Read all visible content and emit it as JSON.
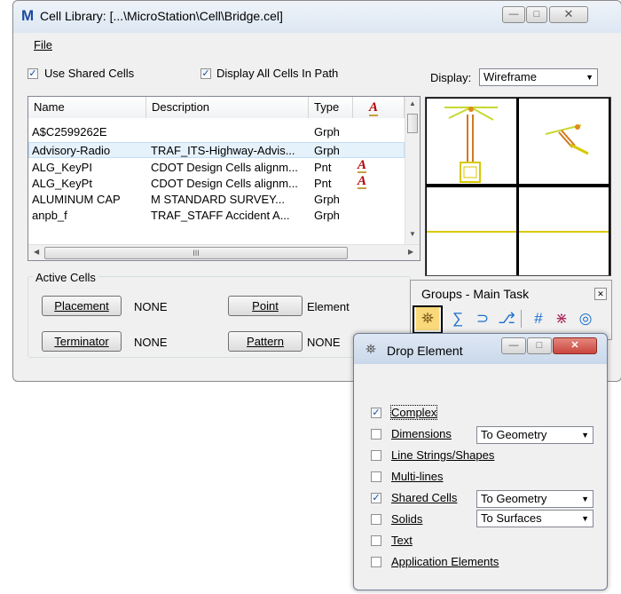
{
  "cell_library": {
    "title": "Cell Library: [...\\MicroStation\\Cell\\Bridge.cel]",
    "menu": {
      "file": "File"
    },
    "use_shared_cells": {
      "label": "Use Shared Cells",
      "checked": true
    },
    "display_all_cells": {
      "label": "Display All Cells In Path",
      "checked": true
    },
    "display": {
      "label": "Display:",
      "value": "Wireframe"
    },
    "columns": [
      "Name",
      "Description",
      "Type"
    ],
    "rows": [
      {
        "name": "A$C2599262E",
        "description": "",
        "type": "Grph",
        "default": false,
        "selected": false
      },
      {
        "name": "Advisory-Radio",
        "description": "TRAF_ITS-Highway-Advis...",
        "type": "Grph",
        "default": false,
        "selected": true
      },
      {
        "name": "ALG_KeyPI",
        "description": "CDOT Design Cells alignm...",
        "type": "Pnt",
        "default": true,
        "selected": false
      },
      {
        "name": "ALG_KeyPt",
        "description": "CDOT Design Cells alignm...",
        "type": "Pnt",
        "default": true,
        "selected": false
      },
      {
        "name": "ALUMINUM CAP",
        "description": "M STANDARD SURVEY...",
        "type": "Grph",
        "default": false,
        "selected": false
      },
      {
        "name": "anpb_f",
        "description": "TRAF_STAFF Accident A...",
        "type": "Grph",
        "default": false,
        "selected": false
      }
    ],
    "hscroll_glyph": "III",
    "active_cells": {
      "label": "Active Cells",
      "placement": {
        "button": "Placement",
        "value": "NONE"
      },
      "point": {
        "button": "Point",
        "value": "Element"
      },
      "terminator": {
        "button": "Terminator",
        "value": "NONE"
      },
      "pattern": {
        "button": "Pattern",
        "value": "NONE"
      }
    }
  },
  "groups_toolbar": {
    "title": "Groups - Main Task",
    "icons": [
      "drop-element-icon",
      "create-complex-chain-icon",
      "create-complex-shape-icon",
      "create-region-icon",
      "hatch-area-icon",
      "crosshatch-area-icon",
      "pattern-area-icon"
    ]
  },
  "drop_element": {
    "title": "Drop Element",
    "items": [
      {
        "label": "Complex",
        "checked": true,
        "option": ""
      },
      {
        "label": "Dimensions",
        "checked": false,
        "option": "To Geometry"
      },
      {
        "label": "Line Strings/Shapes",
        "checked": false,
        "option": ""
      },
      {
        "label": "Multi-lines",
        "checked": false,
        "option": ""
      },
      {
        "label": "Shared Cells",
        "checked": true,
        "option": "To Geometry"
      },
      {
        "label": "Solids",
        "checked": false,
        "option": "To Surfaces"
      },
      {
        "label": "Text",
        "checked": false,
        "option": ""
      },
      {
        "label": "Application Elements",
        "checked": false,
        "option": ""
      }
    ]
  },
  "colors": {
    "selection": "#e5f1fb",
    "close_button": "#c9463d",
    "accent": "#1b6fcf"
  }
}
